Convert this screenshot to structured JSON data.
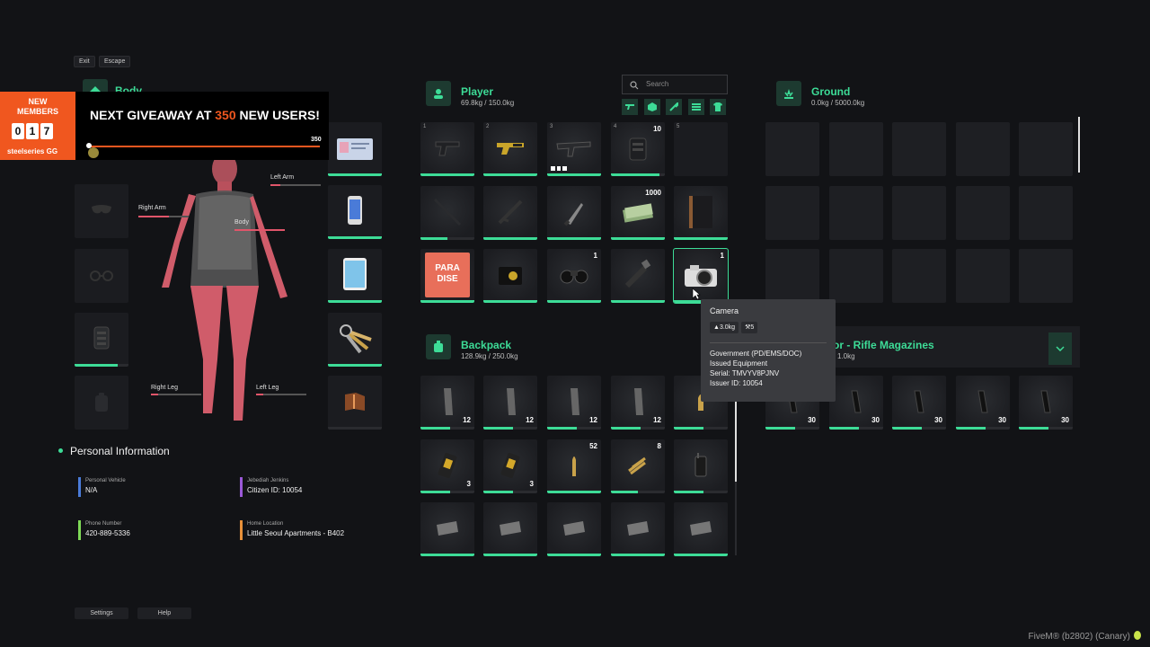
{
  "top_keys": {
    "exit": "Exit",
    "escape": "Escape"
  },
  "banner": {
    "new_members_label": "NEW\nMEMBERS",
    "digits": [
      "0",
      "1",
      "7"
    ],
    "brand": "steelseries GG",
    "headline_pre": "NEXT GIVEAWAY AT ",
    "headline_num": "350",
    "headline_post": " NEW USERS!",
    "progress_max_label": "350"
  },
  "body_panel": {
    "title": "Body",
    "parts": {
      "left_arm": "Left Arm",
      "right_arm": "Right Arm",
      "body": "Body",
      "right_leg": "Right Leg",
      "left_leg": "Left Leg"
    }
  },
  "personal": {
    "title": "Personal Information",
    "items": [
      {
        "label": "Personal Vehicle",
        "value": "N/A",
        "color": "#4a7bd8"
      },
      {
        "label": "Jebediah Jenkins",
        "value": "Citizen ID: 10054",
        "color": "#9b59d8"
      },
      {
        "label": "Phone Number",
        "value": "420-889-5336",
        "color": "#7ed957"
      },
      {
        "label": "Home Location",
        "value": "Little Seoul Apartments - B402",
        "color": "#e8913a"
      }
    ]
  },
  "bottom_buttons": {
    "settings": "Settings",
    "help": "Help"
  },
  "player": {
    "title": "Player",
    "weight": "69.8kg / 150.0kg",
    "search_placeholder": "Search",
    "slot_numbers": [
      "1",
      "2",
      "3",
      "4",
      "5"
    ],
    "counts": {
      "vest": "10",
      "cash": "1000",
      "binoculars": "1",
      "camera": "1"
    }
  },
  "backpack": {
    "title": "Backpack",
    "weight": "128.9kg / 250.0kg",
    "counts": {
      "mag": "12",
      "batt": "3",
      "round": "52",
      "shells": "8"
    }
  },
  "ground": {
    "title": "Ground",
    "weight": "0.0kg / 5000.0kg"
  },
  "armor": {
    "title": "Armor - Rifle Magazines",
    "weight": "1.0kg",
    "count": "30"
  },
  "tooltip": {
    "name": "Camera",
    "weight_chip": "3.0kg",
    "tool_chip": "5",
    "lines": [
      "Government (PD/EMS/DOC)",
      "Issued Equipment",
      "Serial: TMVYV8PJNV",
      "Issuer ID: 10054"
    ]
  },
  "footer": "FiveM® (b2802) (Canary)",
  "colors": {
    "accent": "#3ddc97",
    "health": "#e0556a",
    "banner_orange": "#f0571f"
  }
}
